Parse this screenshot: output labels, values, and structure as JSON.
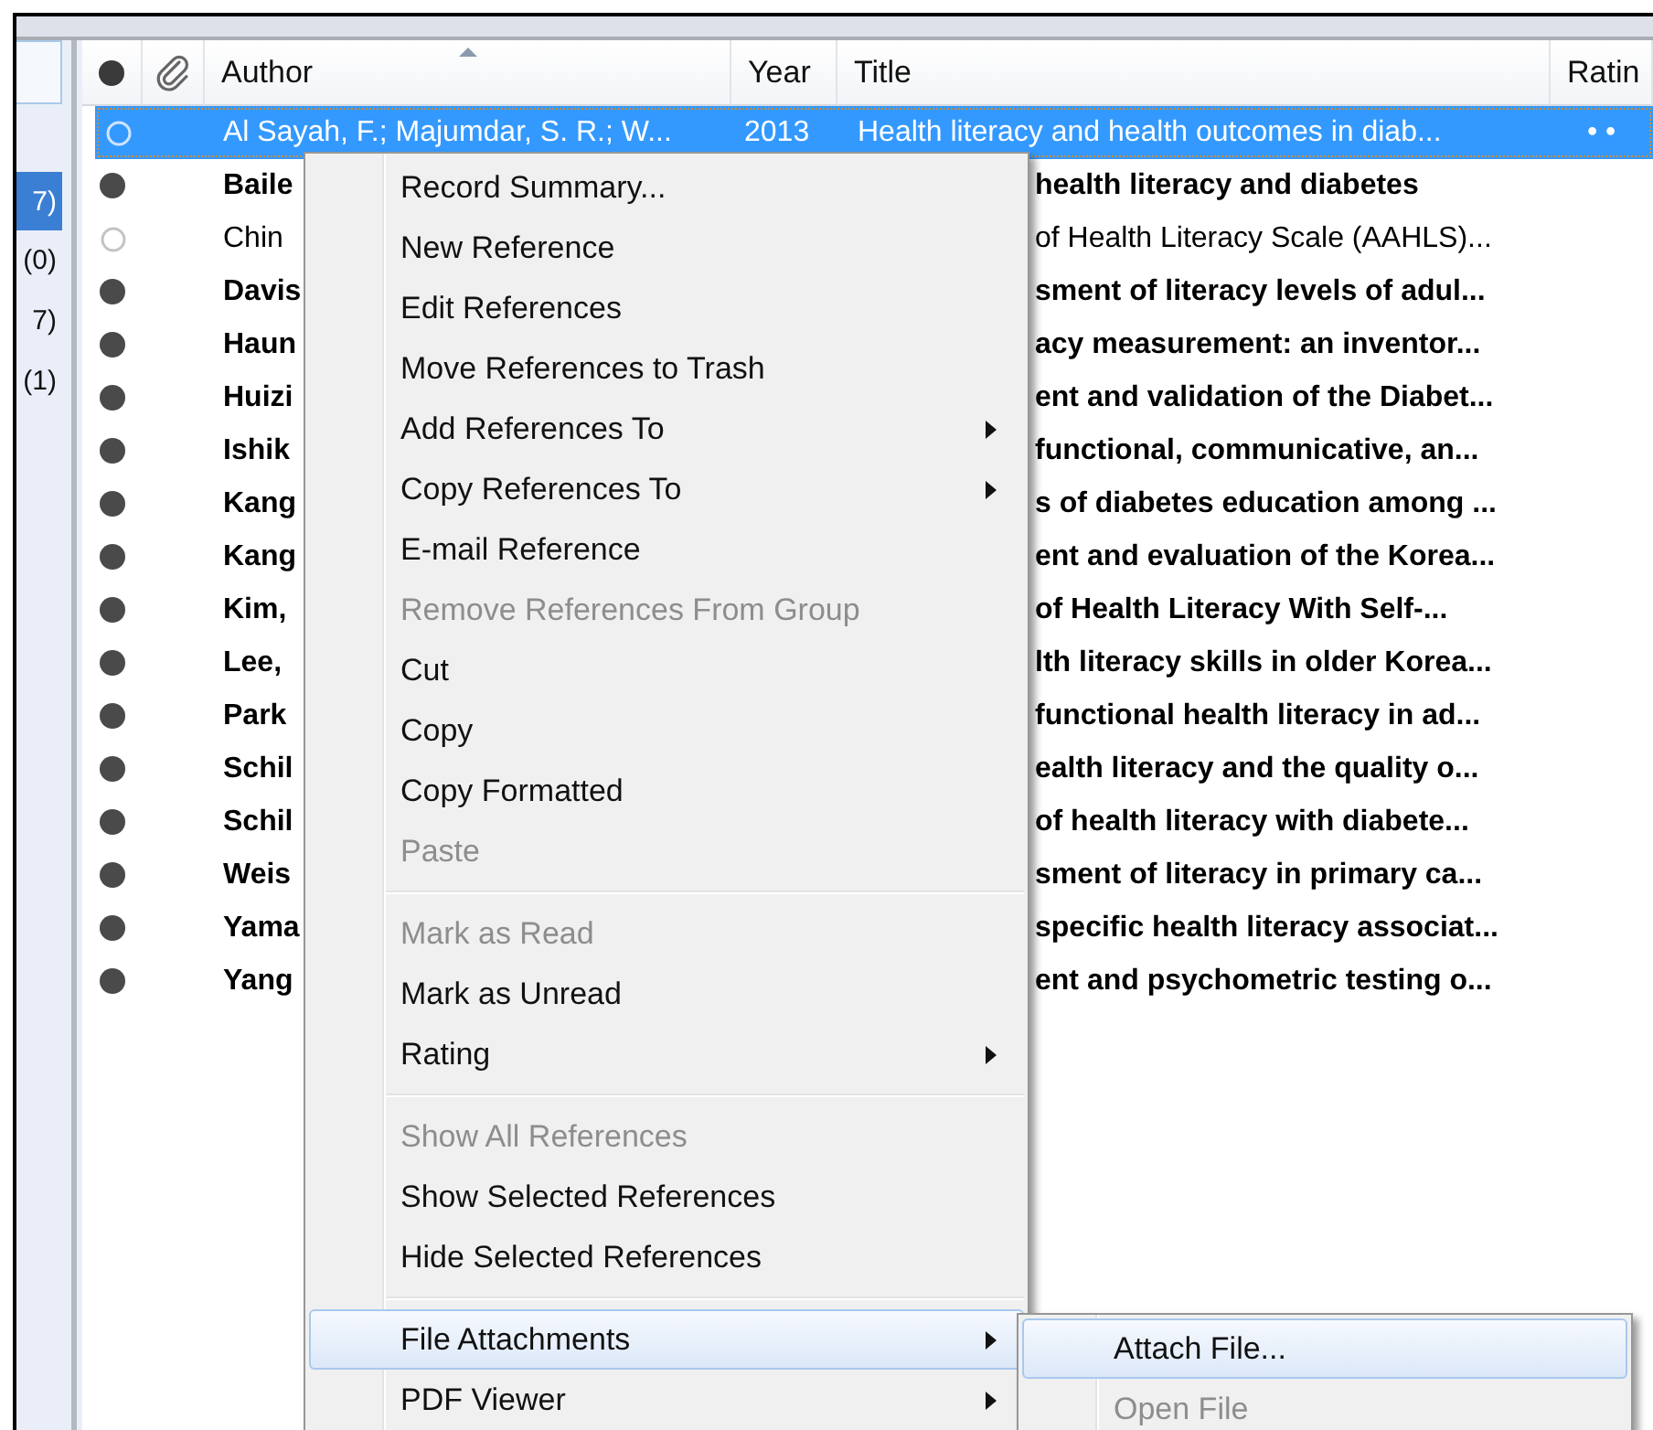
{
  "sidebar": {
    "items": [
      {
        "label": "7)",
        "selected": true
      },
      {
        "label": "(0)",
        "selected": false
      },
      {
        "label": "7)",
        "selected": false
      },
      {
        "label": "(1)",
        "selected": false
      }
    ]
  },
  "table": {
    "columns": [
      {
        "kind": "read-icon"
      },
      {
        "kind": "attachment-icon"
      },
      {
        "kind": "text",
        "label": "Author",
        "sorted": true
      },
      {
        "kind": "text",
        "label": "Year",
        "sorted": false
      },
      {
        "kind": "text",
        "label": "Title",
        "sorted": false
      },
      {
        "kind": "text",
        "label": "Ratin",
        "sorted": false
      }
    ],
    "rows": [
      {
        "read": true,
        "selected": true,
        "author": "Al Sayah, F.; Majumdar, S. R.; W...",
        "year": "2013",
        "title": "Health literacy and health outcomes in diab...",
        "rating": "•   •"
      },
      {
        "read": false,
        "selected": false,
        "author": "Baile",
        "title": "health literacy and diabetes"
      },
      {
        "read": true,
        "selected": false,
        "author": "Chin",
        "title": "of Health Literacy Scale (AAHLS)..."
      },
      {
        "read": false,
        "selected": false,
        "author": "Davis",
        "title": "sment of literacy levels of adul..."
      },
      {
        "read": false,
        "selected": false,
        "author": "Haun",
        "title": "acy measurement: an inventor..."
      },
      {
        "read": false,
        "selected": false,
        "author": "Huizi",
        "title": "ent and validation of the Diabet..."
      },
      {
        "read": false,
        "selected": false,
        "author": "Ishik",
        "title": "functional, communicative, an..."
      },
      {
        "read": false,
        "selected": false,
        "author": "Kang",
        "title": "s of diabetes education among ..."
      },
      {
        "read": false,
        "selected": false,
        "author": "Kang",
        "title": "ent and evaluation of the Korea..."
      },
      {
        "read": false,
        "selected": false,
        "author": "Kim,",
        "title": "of Health Literacy With Self-..."
      },
      {
        "read": false,
        "selected": false,
        "author": "Lee,",
        "title": "lth literacy skills in older Korea..."
      },
      {
        "read": false,
        "selected": false,
        "author": "Park",
        "title": "functional health literacy in ad..."
      },
      {
        "read": false,
        "selected": false,
        "author": "Schil",
        "title": "ealth literacy and the quality o..."
      },
      {
        "read": false,
        "selected": false,
        "author": "Schil",
        "title": "of health literacy with diabete..."
      },
      {
        "read": false,
        "selected": false,
        "author": "Weis",
        "title": "sment of literacy in primary ca..."
      },
      {
        "read": false,
        "selected": false,
        "author": "Yama",
        "title": "specific health literacy associat..."
      },
      {
        "read": false,
        "selected": false,
        "author": "Yang",
        "title": "ent and psychometric testing o..."
      }
    ]
  },
  "context_menu": {
    "items": [
      {
        "kind": "item",
        "label": "Record Summary...",
        "disabled": false,
        "submenu": false,
        "selected": false
      },
      {
        "kind": "item",
        "label": "New Reference",
        "disabled": false,
        "submenu": false,
        "selected": false
      },
      {
        "kind": "item",
        "label": "Edit References",
        "disabled": false,
        "submenu": false,
        "selected": false
      },
      {
        "kind": "item",
        "label": "Move References to Trash",
        "disabled": false,
        "submenu": false,
        "selected": false
      },
      {
        "kind": "item",
        "label": "Add References To",
        "disabled": false,
        "submenu": true,
        "selected": false
      },
      {
        "kind": "item",
        "label": "Copy References To",
        "disabled": false,
        "submenu": true,
        "selected": false
      },
      {
        "kind": "item",
        "label": "E-mail Reference",
        "disabled": false,
        "submenu": false,
        "selected": false
      },
      {
        "kind": "item",
        "label": "Remove References From Group",
        "disabled": true,
        "submenu": false,
        "selected": false
      },
      {
        "kind": "item",
        "label": "Cut",
        "disabled": false,
        "submenu": false,
        "selected": false
      },
      {
        "kind": "item",
        "label": "Copy",
        "disabled": false,
        "submenu": false,
        "selected": false
      },
      {
        "kind": "item",
        "label": "Copy Formatted",
        "disabled": false,
        "submenu": false,
        "selected": false
      },
      {
        "kind": "item",
        "label": "Paste",
        "disabled": true,
        "submenu": false,
        "selected": false
      },
      {
        "kind": "separator"
      },
      {
        "kind": "item",
        "label": "Mark as Read",
        "disabled": true,
        "submenu": false,
        "selected": false
      },
      {
        "kind": "item",
        "label": "Mark as Unread",
        "disabled": false,
        "submenu": false,
        "selected": false
      },
      {
        "kind": "item",
        "label": "Rating",
        "disabled": false,
        "submenu": true,
        "selected": false
      },
      {
        "kind": "separator"
      },
      {
        "kind": "item",
        "label": "Show All References",
        "disabled": true,
        "submenu": false,
        "selected": false
      },
      {
        "kind": "item",
        "label": "Show Selected References",
        "disabled": false,
        "submenu": false,
        "selected": false
      },
      {
        "kind": "item",
        "label": "Hide Selected References",
        "disabled": false,
        "submenu": false,
        "selected": false
      },
      {
        "kind": "separator"
      },
      {
        "kind": "item",
        "label": "File Attachments",
        "disabled": false,
        "submenu": true,
        "selected": true
      },
      {
        "kind": "item",
        "label": "PDF Viewer",
        "disabled": false,
        "submenu": true,
        "selected": false
      }
    ]
  },
  "submenu": {
    "items": [
      {
        "kind": "item",
        "label": "Attach File...",
        "disabled": false,
        "submenu": false,
        "selected": true
      },
      {
        "kind": "item",
        "label": "Open File",
        "disabled": true,
        "submenu": false,
        "selected": false
      }
    ]
  }
}
